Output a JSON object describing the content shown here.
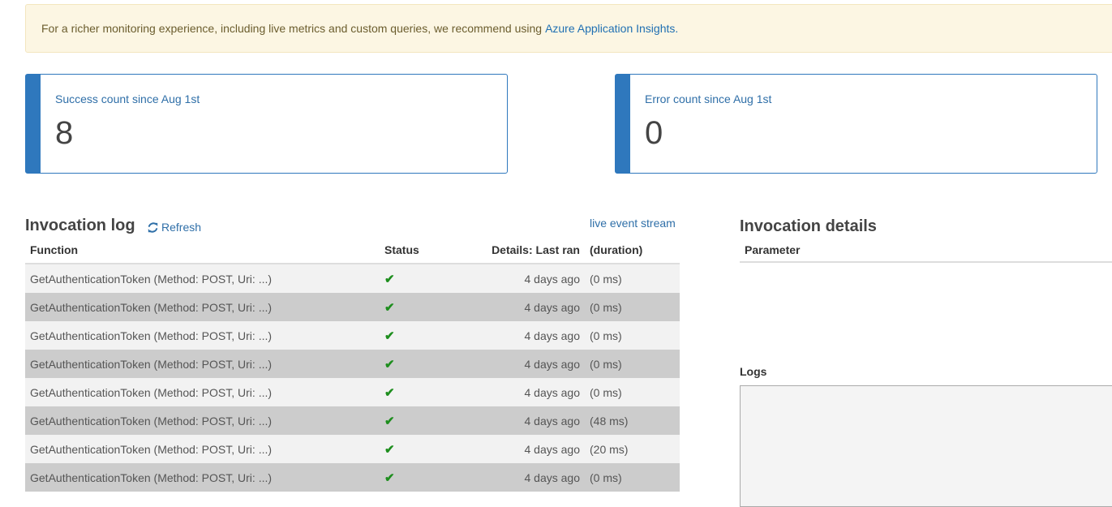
{
  "banner": {
    "text": "For a richer monitoring experience, including live metrics and custom queries, we recommend using",
    "link": "Azure Application Insights."
  },
  "cards": [
    {
      "label": "Success count since Aug 1st",
      "value": "8"
    },
    {
      "label": "Error count since Aug 1st",
      "value": "0"
    }
  ],
  "invocation_log": {
    "title": "Invocation log",
    "refresh_label": "Refresh",
    "live_stream_label": "live event stream",
    "columns": {
      "function": "Function",
      "status": "Status",
      "details": "Details: Last ran",
      "duration": "(duration)"
    },
    "rows": [
      {
        "function": "GetAuthenticationToken (Method: POST, Uri: ...)",
        "last_ran": "4 days ago",
        "duration": "(0 ms)"
      },
      {
        "function": "GetAuthenticationToken (Method: POST, Uri: ...)",
        "last_ran": "4 days ago",
        "duration": "(0 ms)"
      },
      {
        "function": "GetAuthenticationToken (Method: POST, Uri: ...)",
        "last_ran": "4 days ago",
        "duration": "(0 ms)"
      },
      {
        "function": "GetAuthenticationToken (Method: POST, Uri: ...)",
        "last_ran": "4 days ago",
        "duration": "(0 ms)"
      },
      {
        "function": "GetAuthenticationToken (Method: POST, Uri: ...)",
        "last_ran": "4 days ago",
        "duration": "(0 ms)"
      },
      {
        "function": "GetAuthenticationToken (Method: POST, Uri: ...)",
        "last_ran": "4 days ago",
        "duration": "(48 ms)"
      },
      {
        "function": "GetAuthenticationToken (Method: POST, Uri: ...)",
        "last_ran": "4 days ago",
        "duration": "(20 ms)"
      },
      {
        "function": "GetAuthenticationToken (Method: POST, Uri: ...)",
        "last_ran": "4 days ago",
        "duration": "(0 ms)"
      }
    ]
  },
  "invocation_details": {
    "title": "Invocation details",
    "parameter_header": "Parameter",
    "logs_label": "Logs"
  },
  "icons": {
    "refresh": "refresh-icon",
    "status": "check-icon"
  },
  "colors": {
    "accent": "#2f78bd",
    "success": "#1e8e1e",
    "banner_bg": "#fcf6e3"
  }
}
